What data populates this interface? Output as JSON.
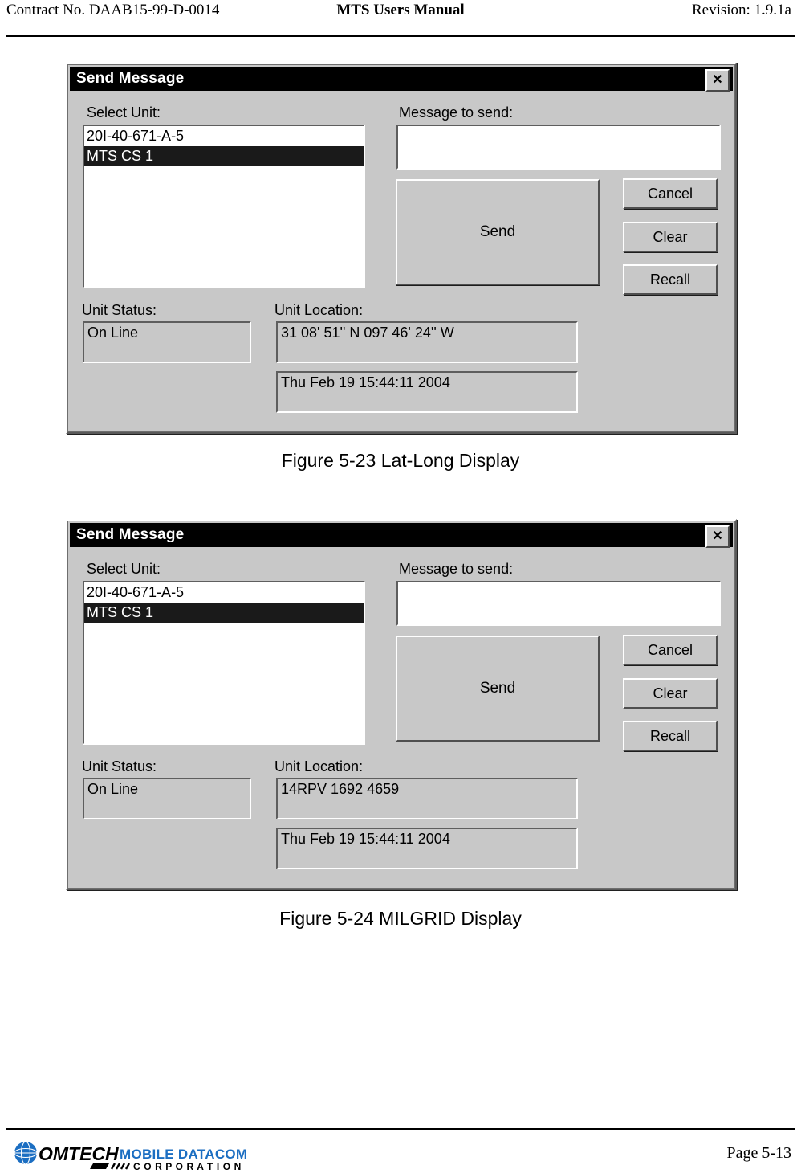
{
  "header": {
    "contract": "Contract No. DAAB15-99-D-0014",
    "title": "MTS Users Manual",
    "revision": "Revision:  1.9.1a"
  },
  "dialogs": [
    {
      "title": "Send Message",
      "close_label": "✕",
      "labels": {
        "select_unit": "Select Unit:",
        "message_to_send": "Message to send:",
        "unit_status": "Unit Status:",
        "unit_location": "Unit Location:"
      },
      "unit_list": [
        {
          "label": "20I-40-671-A-5",
          "selected": false
        },
        {
          "label": "MTS CS 1",
          "selected": true
        }
      ],
      "message_value": "",
      "message_placeholder": "",
      "buttons": {
        "send": "Send",
        "cancel": "Cancel",
        "clear": "Clear",
        "recall": "Recall"
      },
      "unit_status_value": "On Line",
      "unit_location_value": "31 08' 51'' N 097 46' 24'' W",
      "timestamp_value": "Thu Feb 19 15:44:11 2004"
    },
    {
      "title": "Send Message",
      "close_label": "✕",
      "labels": {
        "select_unit": "Select Unit:",
        "message_to_send": "Message to send:",
        "unit_status": "Unit Status:",
        "unit_location": "Unit Location:"
      },
      "unit_list": [
        {
          "label": "20I-40-671-A-5",
          "selected": false
        },
        {
          "label": "MTS CS 1",
          "selected": true
        }
      ],
      "message_value": "",
      "message_placeholder": "",
      "buttons": {
        "send": "Send",
        "cancel": "Cancel",
        "clear": "Clear",
        "recall": "Recall"
      },
      "unit_status_value": "On Line",
      "unit_location_value": "14RPV 1692 4659",
      "timestamp_value": "Thu Feb 19 15:44:11 2004"
    }
  ],
  "captions": [
    "Figure 5-23   Lat-Long Display",
    "Figure 5-24   MILGRID Display"
  ],
  "footer": {
    "logo_primary": "OMTECH",
    "logo_secondary": "MOBILE DATACOM",
    "logo_tertiary": "C O R P O R A T I O N",
    "page_number": "Page 5-13",
    "logo_accent_color": "#1b6ec2"
  }
}
